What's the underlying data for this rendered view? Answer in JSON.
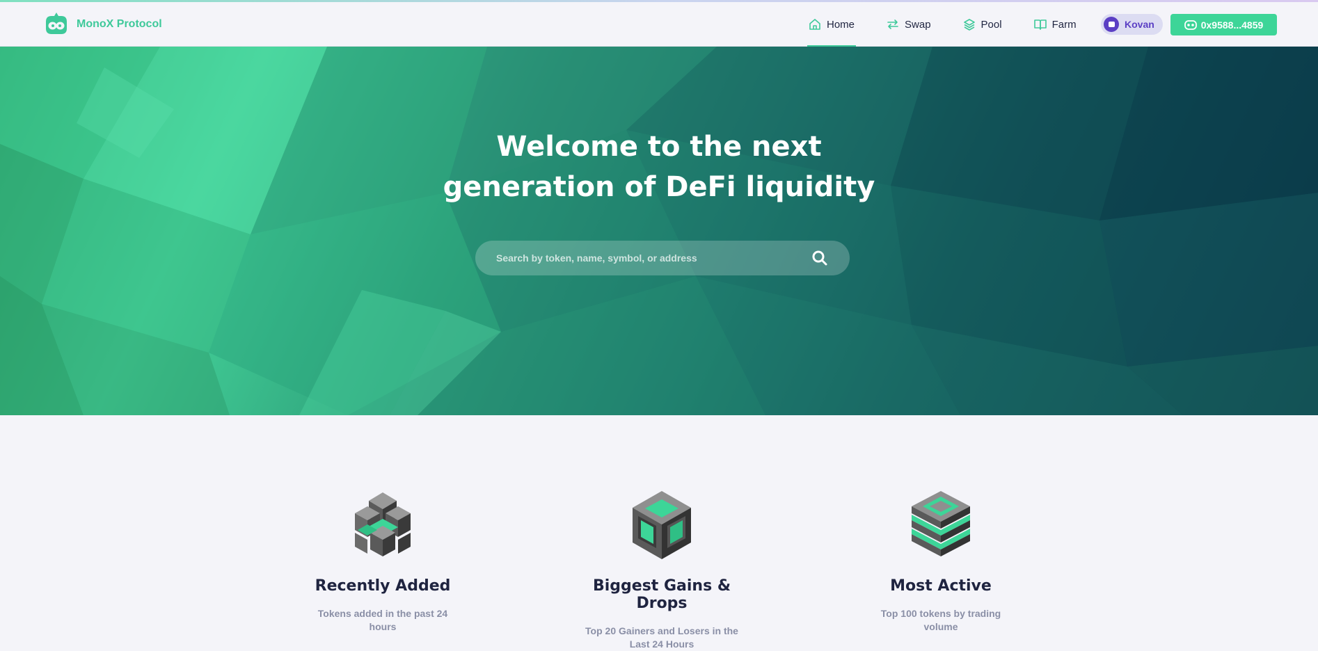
{
  "brand": {
    "name": "MonoX Protocol",
    "icon": "monox-logo-icon",
    "color": "#3ec99a"
  },
  "nav": {
    "items": [
      {
        "label": "Home",
        "icon": "home-icon",
        "active": true
      },
      {
        "label": "Swap",
        "icon": "swap-arrows-icon",
        "active": false
      },
      {
        "label": "Pool",
        "icon": "layers-icon",
        "active": false
      },
      {
        "label": "Farm",
        "icon": "book-icon",
        "active": false
      }
    ],
    "network": "Kovan",
    "wallet": "0x9588...4859"
  },
  "hero": {
    "title_line1": "Welcome to the next",
    "title_line2": "generation of DeFi liquidity",
    "search_placeholder": "Search by token, name, symbol, or address"
  },
  "features": [
    {
      "title": "Recently Added",
      "description": "Tokens added in the past 24 hours",
      "icon": "cubes-cluster-icon"
    },
    {
      "title": "Biggest Gains & Drops",
      "description": "Top 20 Gainers and Losers in the Last 24 Hours",
      "icon": "hollow-cube-icon"
    },
    {
      "title": "Most Active",
      "description": "Top 100 tokens by trading volume",
      "icon": "stacked-layers-icon"
    }
  ],
  "colors": {
    "accent": "#3dd598",
    "network": "#5b3fc4",
    "heading": "#1f2440",
    "muted": "#8a8fa6"
  }
}
